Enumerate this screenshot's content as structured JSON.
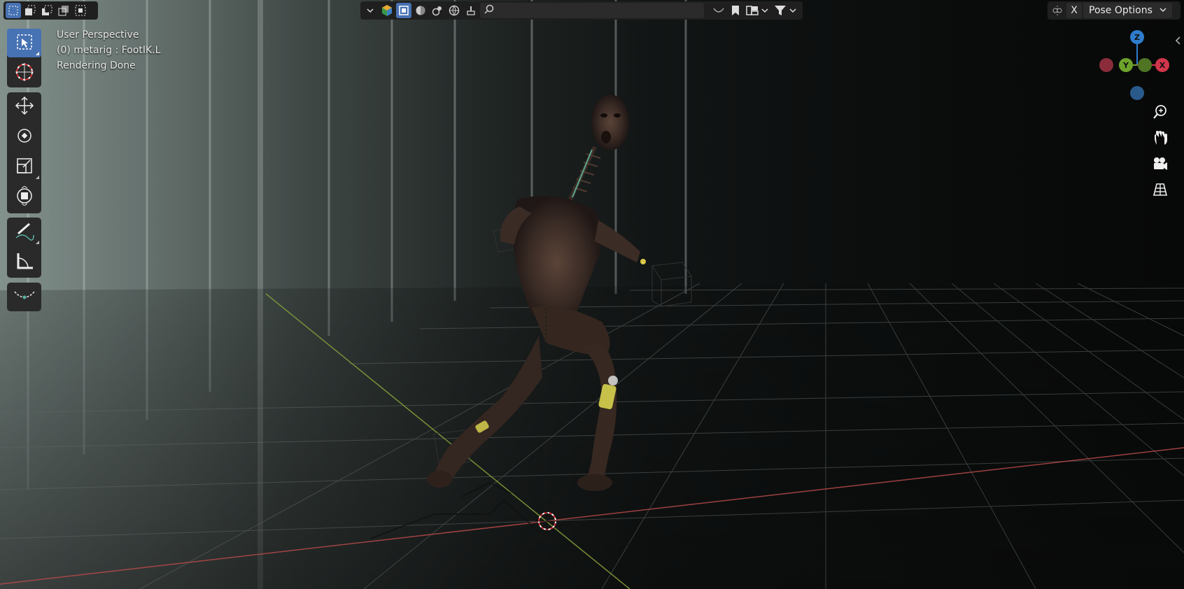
{
  "viewport": {
    "view_name": "User Perspective",
    "object_info": "(0) metarig : FootIK.L",
    "status": "Rendering Done"
  },
  "header": {
    "search_placeholder": "",
    "pose_options_label": "Pose Options",
    "x_button_label": "X",
    "select_modes": [
      "select-new-icon",
      "select-extend-icon",
      "select-subtract-icon",
      "select-invert-icon",
      "select-intersect-icon"
    ],
    "shading_icons": [
      "chevron-down-icon",
      "viewport-shading-icon",
      "wireframe-icon",
      "solid-icon",
      "material-preview-icon",
      "rendered-icon",
      "brush-icon",
      "search-icon"
    ],
    "right_icons": [
      "overlay-icon",
      "bookmark-icon",
      "collection-icon",
      "filter-icon"
    ]
  },
  "toolbar": {
    "tools": [
      "select-box",
      "cursor",
      "move",
      "rotate",
      "scale",
      "transform",
      "annotate",
      "measure",
      "relax"
    ]
  },
  "gizmo": {
    "axes": {
      "z": "Z",
      "y": "Y",
      "x": "X"
    },
    "colors": {
      "z": "#2e7ccc",
      "y": "#6ea32b",
      "x": "#d1364a",
      "neg_x": "#8a2c3a",
      "neg_y": "#4f7424",
      "neg_z": "#2a5a8c"
    },
    "nav_buttons": [
      "zoom-icon",
      "pan-hand-icon",
      "camera-icon",
      "grid-icon"
    ]
  },
  "colors": {
    "accent": "#4772b3",
    "x_axis": "#b84a4a",
    "y_axis": "#8aa33a",
    "panel": "#1f1f1f"
  }
}
